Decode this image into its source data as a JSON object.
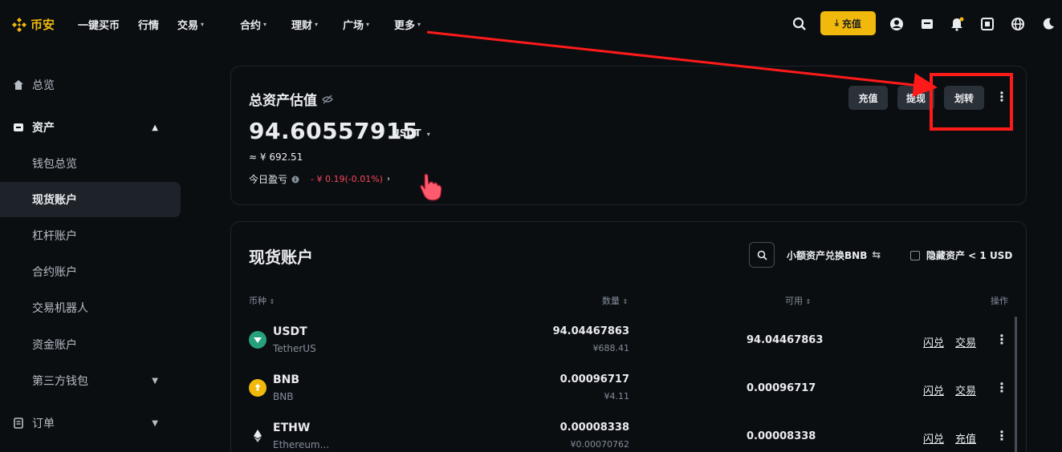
{
  "nav": {
    "logo": "币安",
    "items": [
      "一键买币",
      "行情",
      "交易",
      "合约",
      "理财",
      "广场",
      "更多"
    ],
    "deposit": "充值"
  },
  "sidebar": {
    "overview": "总览",
    "assets": "资产",
    "sub": [
      "钱包总览",
      "现货账户",
      "杠杆账户",
      "合约账户",
      "交易机器人",
      "资金账户",
      "第三方钱包"
    ],
    "orders": "订单"
  },
  "summary": {
    "title": "总资产估值",
    "amount": "94.60557915",
    "unit": "USDT",
    "cny": "≈ ¥ 692.51",
    "pnl_label": "今日盈亏",
    "pnl_value": "- ¥ 0.19(-0.01%)",
    "btn_deposit": "充值",
    "btn_withdraw": "提现",
    "btn_transfer": "划转"
  },
  "spot": {
    "title": "现货账户",
    "convert": "小额资产兑换BNB",
    "hide_small": "隐藏资产 < 1 USD",
    "headers": {
      "coin": "币种",
      "qty": "数量",
      "avail": "可用",
      "ops": "操作"
    },
    "rows": [
      {
        "symbol": "USDT",
        "name": "TetherUS",
        "qty": "94.04467863",
        "qty_cny": "¥688.41",
        "avail": "94.04467863",
        "op1": "闪兑",
        "op2": "交易",
        "icon": "usdt-coin-icon",
        "color": "#26a17b"
      },
      {
        "symbol": "BNB",
        "name": "BNB",
        "qty": "0.00096717",
        "qty_cny": "¥4.11",
        "avail": "0.00096717",
        "op1": "闪兑",
        "op2": "交易",
        "icon": "bnb-coin-icon",
        "color": "#f0b90b"
      },
      {
        "symbol": "ETHW",
        "name": "Ethereum...",
        "qty": "0.00008338",
        "qty_cny": "¥0.00070762",
        "avail": "0.00008338",
        "op1": "闪兑",
        "op2": "充值",
        "icon": "ethw-coin-icon",
        "color": "#c0c4cc"
      }
    ]
  },
  "colors": {
    "accent": "#f0b90b",
    "negative": "#f6465d",
    "annotation": "#ff1a1a"
  }
}
